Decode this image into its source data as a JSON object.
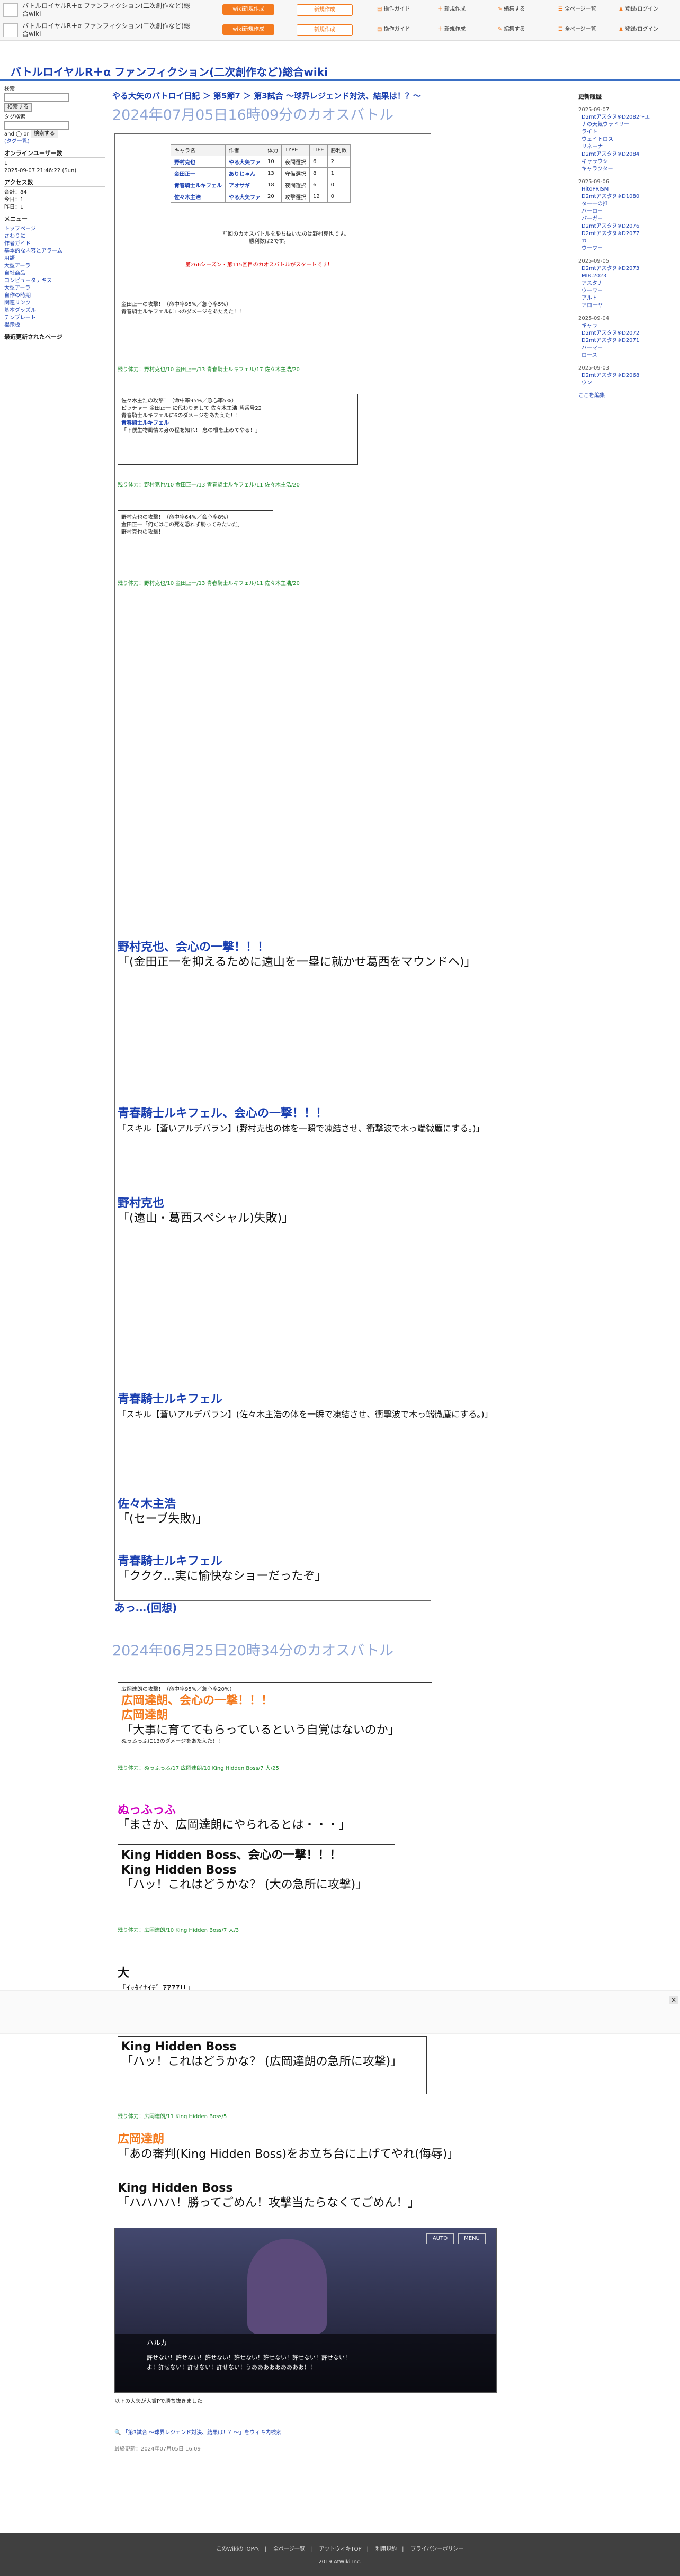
{
  "header": {
    "site_name": "バトルロイヤルR＋α ファンフィクション(二次創作など)総合wiki",
    "wiki_button": "wiki新規作成",
    "new_create": "新規作成",
    "nav": [
      "操作ガイド",
      "新規作成",
      "編集する",
      "全ページ一覧",
      "登録/ログイン"
    ]
  },
  "site_title": "バトルロイヤルR＋α ファンフィクション(二次創作など)総合wiki",
  "left": {
    "search_placeholder": "検索",
    "search_button": "検索する",
    "tag_search": "タグ検索",
    "and_or": "and ◯ or",
    "search_button2": "検索する",
    "tag_link": "(タグ一覧)",
    "online_title": "オンラインユーザー数",
    "online_count": "1",
    "date": "2025-09-07 21:46:22 (Sun)",
    "access_title": "アクセス数",
    "access_total": "合計：84",
    "access_today": "今日：1",
    "access_yesterday": "昨日：1",
    "menu_title": "メニュー",
    "menu_items": [
      "トップページ",
      "さわりに",
      "作者ガイド",
      "基本的な内容とアラーム",
      "用語",
      "大型アーラ",
      "自社商品",
      "コンピュータテキス",
      "大型アーラ",
      "自作の時期",
      "関連リンク",
      "基本グッズル",
      "テンプレート",
      "掲示板"
    ],
    "recent_title": "最近更新されたページ"
  },
  "right": {
    "title": "更新履歴",
    "groups": [
      {
        "date": "2025-09-07",
        "items": [
          "D2mtアスタヌ※D2082～エ",
          "ナの天気ウラドリー",
          "ライト",
          "ウェイトロス",
          "リネーナ",
          "D2mtアスタヌ※D2084",
          "キャラウシ",
          "キャラクター"
        ]
      },
      {
        "date": "2025-09-06",
        "items": [
          "HitoPRISM",
          "D2mtアスタヌ※D1080",
          "ター一の推",
          "バーロー",
          "バーガー",
          "D2mtアスタヌ※D2076",
          "D2mtアスタヌ※D2077",
          "カ",
          "ウーワー"
        ]
      },
      {
        "date": "2025-09-05",
        "items": [
          "D2mtアスタヌ※D2073",
          "MIB.2023",
          "アスタナ",
          "ウーワー",
          "アルト",
          "アローヤ"
        ]
      },
      {
        "date": "2025-09-04",
        "items": [
          "キャラ",
          "D2mtアスタヌ※D2072",
          "D2mtアスタヌ※D2071",
          "ハーマー",
          "ロース"
        ]
      },
      {
        "date": "2025-09-03",
        "items": [
          "D2mtアスタヌ※D2068",
          "ウン"
        ]
      }
    ],
    "more": "ここを編集"
  },
  "main": {
    "breadcrumb": "やる大矢のバトロイ日記 ＞ 第5節7 ＞ 第3試合 〜球界レジェンド対決、結果は！？〜",
    "heading": "2024年07月05日16時09分のカオスバトル",
    "table_header": [
      "キャラ名",
      "作者",
      "体力",
      "TYPE",
      "LIFE",
      "勝利数"
    ],
    "table_rows": [
      [
        "野村克也",
        "やる大矢ファ",
        "10",
        "夜間選択",
        "6",
        "2"
      ],
      [
        "金田正一",
        "ありじゃん",
        "13",
        "守備選択",
        "8",
        "1"
      ],
      [
        "青春騎士ルキフェル",
        "アオサギ",
        "18",
        "夜間選択",
        "6",
        "0"
      ],
      [
        "佐々木主浩",
        "やる大矢ファ",
        "20",
        "攻撃選択",
        "12",
        "0"
      ]
    ],
    "intro1": "前回のカオスバトルを勝ち抜いたのは野村克也です。",
    "intro2": "勝利数は2です。",
    "intro3": "第266シーズン・第115回目のカオスバトルがスタートです！",
    "log": [
      "金田正一の攻撃！（命中率95%／急心率5%）",
      "青春騎士ルキフェルに13のダメージをあたえた！！",
      "残り体力：野村克也/10 金田正一/13 青春騎士ルキフェル/17 佐々木主浩/20",
      "佐々木主浩の攻撃！（命中率95%／急心率5%）",
      "ピッチャー 金田正一 に代わりまして 佐々木主浩 背番号22",
      "青春騎士ルキフェルに6のダメージをあたえた！！",
      "青春騎士ルキフェル",
      "「下僕生物風情の身の程を知れ！ 息の根を止めてやる！」",
      "残り体力：野村克也/10 金田正一/13 青春騎士ルキフェル/11 佐々木主浩/20",
      "野村克也の攻撃！（命中率64%／会心率8%）",
      "金田正一「何だはこの死を恐れず勝ってみたいだ」",
      "野村克也の攻撃！",
      "残り体力：野村克也/10 金田正一/13 青春騎士ルキフェル/11 佐々木主浩/20"
    ],
    "big_lines": [
      "野村克也、会心の一撃！！！",
      "「(金田正一を抑えるために遠山を一塁に就かせ葛西をマウンドへ)」",
      "青春騎士ルキフェル、会心の一撃！！！",
      "「スキル【蒼いアルデバラン】(野村克也の体を一瞬で凍結させ、衝撃波で木っ端微塵にする。)」",
      "野村克也",
      "「(遠山・葛西スペシャル)失敗)」",
      "青春騎士ルキフェル",
      "「スキル【蒼いアルデバラン】(佐々木主浩の体を一瞬で凍結させ、衝撃波で木っ端微塵にする。)」",
      "佐々木主浩",
      "「(セーブ失敗)」",
      "青春騎士ルキフェル",
      "「ククク…実に愉快なショーだったぞ」"
    ],
    "back_link": "あっ…(回想)",
    "heading2": "2024年06月25日20時34分のカオスバトル",
    "log2": [
      "広岡達朗の攻撃！（命中率95%／急心率20%）",
      "広岡達朗、会心の一撃！！！",
      "広岡達朗",
      "「大事に育ててもらっているという自覚はないのか」",
      "ぬっふっふに13のダメージをあたえた！！",
      "残り体力：ぬっふっふ/17 広岡達朗/10 King Hidden Boss/7 大/25",
      "ぬっふっふ",
      "「まさか、広岡達朗にやられるとは・・・」",
      "King Hidden Boss、会心の一撃！！！",
      "King Hidden Boss",
      "「ハッ！これはどうかな？ (大の急所に攻撃)」",
      "残り体力：広岡達朗/10 King Hidden Boss/7 大/3",
      "大",
      "「ｲｯﾀｲﾅｲﾃﾞ ｱｱｱｱ!!」",
      "King Hidden Boss",
      "「ハッ！これはどうかな？ (広岡達朗の急所に攻撃)」",
      "残り体力：広岡達朗/11 King Hidden Boss/5",
      "広岡達朗",
      "「あの審判(King Hidden Boss)をお立ち台に上げてやれ(侮辱)」",
      "King Hidden Boss",
      "「ハハハハ！勝ってごめん！攻撃当たらなくてごめん！」"
    ],
    "game_name": "ハルカ",
    "game_auto": "AUTO",
    "game_menu": "MENU",
    "game_text1": "許せない！許せない！許せない！許せない！許せない！許せない！許せない！",
    "game_text2": "よ！許せない！許せない！許せない！うあああああああああ！！",
    "winner_line": "以下の大矢が大賞Pで勝ち抜きました",
    "comment_link": "「第3試合 〜球界レジェンド対決、結果は！？〜」をウィキ内検索",
    "updated": "最終更新：2024年07月05日 16:09"
  },
  "footer": {
    "links": [
      "このWikiのTOPへ",
      "全ページ一覧",
      "アットウィキTOP",
      "利用規約",
      "プライバシーポリシー"
    ],
    "copyright": "2019 AtWiki Inc."
  },
  "colors": {
    "accent": "#f47a1f",
    "link": "#1a3fb0",
    "heading": "#8ea5d6",
    "highlight_green": "#1a8a2a"
  }
}
